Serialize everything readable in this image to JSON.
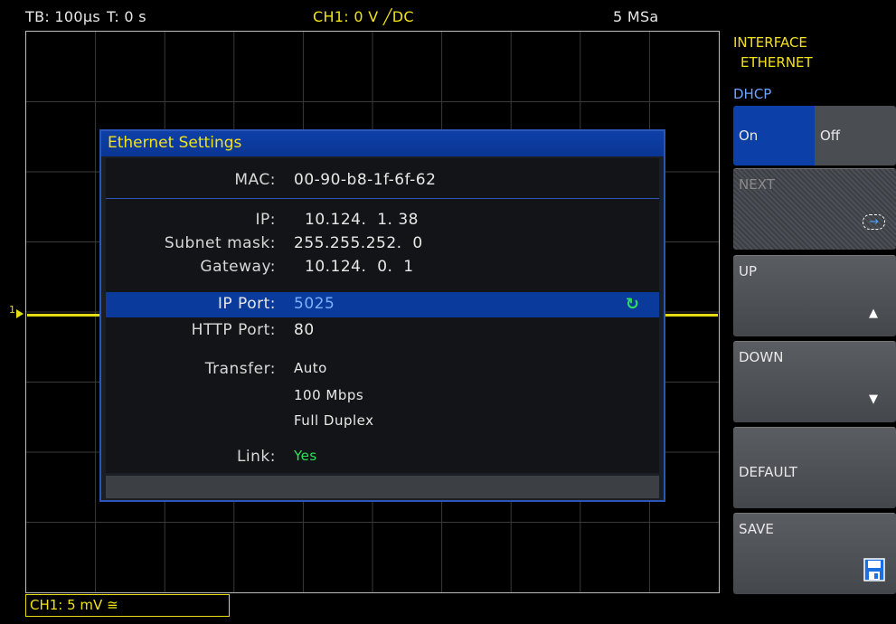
{
  "status": {
    "timebase": "TB: 100µs",
    "trigger_time": "T: 0 s",
    "channel": "CH1: 0 V ╱DC",
    "sample_rate": "5 MSa"
  },
  "channel_marker": "1",
  "channel_label": "CH1: 5 mV ≅",
  "dialog": {
    "title": "Ethernet Settings",
    "fields": {
      "mac_label": "MAC:",
      "mac_value": "00-90-b8-1f-6f-62",
      "ip_label": "IP:",
      "ip_value": "10.124.  1. 38",
      "subnet_label": "Subnet mask:",
      "subnet_value": "255.255.252.  0",
      "gateway_label": "Gateway:",
      "gateway_value": "10.124.  0.  1",
      "ip_port_label": "IP Port:",
      "ip_port_value": "5025",
      "http_port_label": "HTTP Port:",
      "http_port_value": "80",
      "transfer_label": "Transfer:",
      "transfer_mode": "Auto",
      "transfer_speed": "100 Mbps",
      "transfer_duplex": "Full Duplex",
      "link_label": "Link:",
      "link_value": "Yes"
    },
    "colors": {
      "title_text": "#f2e21a",
      "highlight": "#0a3a9b",
      "link_ok": "#2fe05a"
    }
  },
  "panel": {
    "header_line1": "INTERFACE",
    "header_line2": "ETHERNET",
    "dhcp_label": "DHCP",
    "dhcp_on": "On",
    "dhcp_off": "Off",
    "dhcp_selected": "On",
    "keys": {
      "next": "NEXT",
      "up": "UP",
      "down": "DOWN",
      "default": "DEFAULT",
      "save": "SAVE"
    },
    "icons": {
      "next": "arrow-right-dashed-icon",
      "up": "triangle-up-icon",
      "down": "triangle-down-icon",
      "save": "floppy-disk-icon"
    }
  }
}
